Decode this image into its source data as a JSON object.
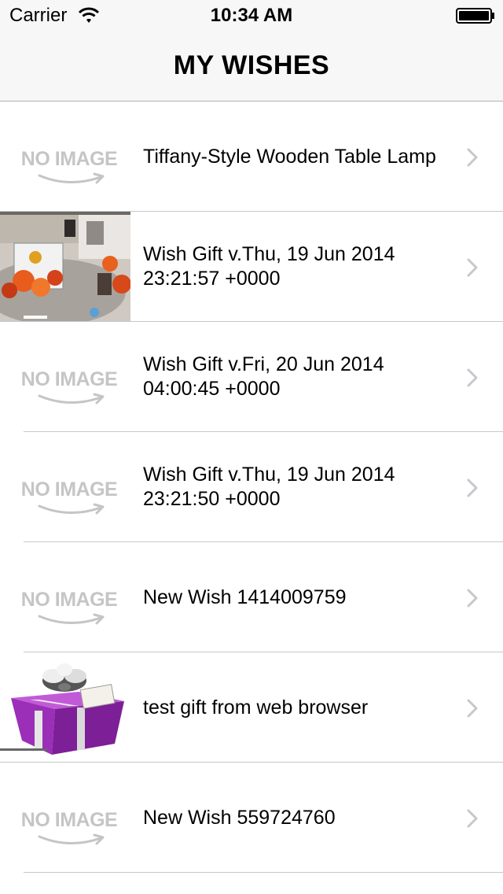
{
  "status_bar": {
    "carrier": "Carrier",
    "time": "10:34 AM"
  },
  "nav": {
    "title": "MY WISHES"
  },
  "placeholder": {
    "text": "NO IMAGE"
  },
  "wishes": [
    {
      "title": "Tiffany-Style Wooden Table Lamp",
      "image": "no-image"
    },
    {
      "title": "Wish Gift v.Thu, 19 Jun 2014 23:21:57 +0000",
      "image": "photo"
    },
    {
      "title": "Wish Gift v.Fri, 20 Jun 2014 04:00:45 +0000",
      "image": "no-image"
    },
    {
      "title": "Wish Gift v.Thu, 19 Jun 2014 23:21:50 +0000",
      "image": "no-image"
    },
    {
      "title": "New Wish 1414009759",
      "image": "no-image"
    },
    {
      "title": "test gift from web browser",
      "image": "gift-box"
    },
    {
      "title": "New Wish 559724760",
      "image": "no-image"
    }
  ],
  "colors": {
    "nav_bg": "#f7f7f7",
    "separator": "#c8c7cc",
    "chevron": "#c7c7cc",
    "placeholder_text": "#c5c5c5",
    "gift_purple": "#9b2fb8"
  },
  "icons": [
    "wifi-icon",
    "battery-icon",
    "chevron-right-icon"
  ]
}
